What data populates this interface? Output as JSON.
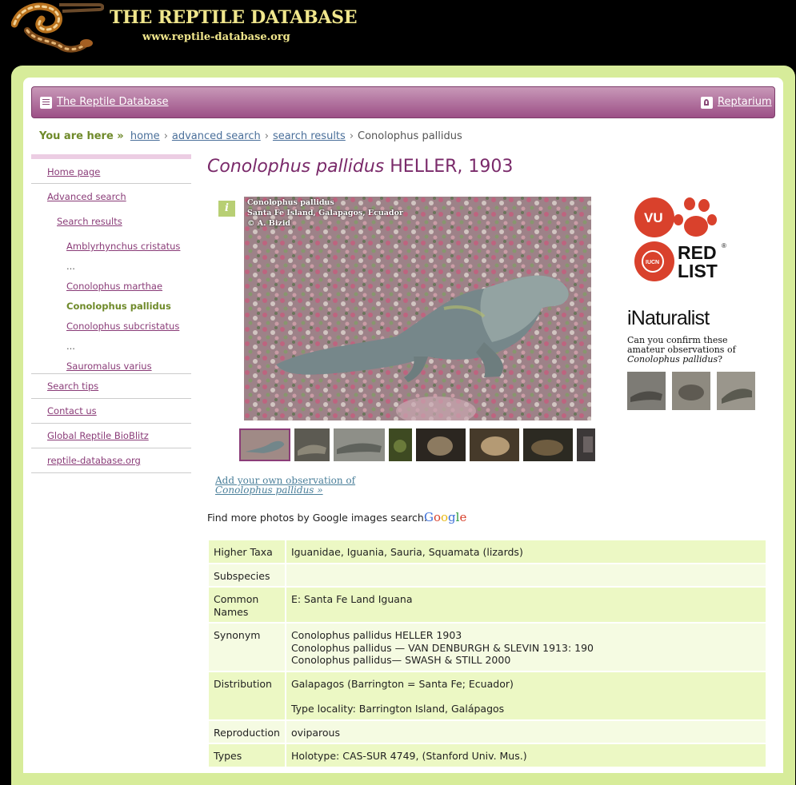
{
  "header": {
    "title": "THE REPTILE DATABASE",
    "url": "www.reptile-database.org"
  },
  "navbar": {
    "home_link": "The Reptile Database",
    "reptarium_link": "Reptarium"
  },
  "breadcrumb": {
    "here": "You are here »",
    "items": [
      "home",
      "advanced search",
      "search results"
    ],
    "current": "Conolophus pallidus",
    "separator": "›"
  },
  "sidebar": {
    "items": [
      {
        "label": "Home page"
      },
      {
        "label": "Advanced search"
      },
      {
        "label": "Search results"
      },
      {
        "label": "Amblyrhynchus cristatus"
      },
      {
        "label": "..."
      },
      {
        "label": "Conolophus marthae"
      },
      {
        "label": "Conolophus pallidus"
      },
      {
        "label": "Conolophus subcristatus"
      },
      {
        "label": "..."
      },
      {
        "label": "Sauromalus varius"
      },
      {
        "label": "Search tips"
      },
      {
        "label": "Contact us"
      },
      {
        "label": "Global Reptile BioBlitz"
      },
      {
        "label": "reptile-database.org"
      }
    ]
  },
  "species": {
    "genus_species": "Conolophus pallidus",
    "author": "HELLER, 1903"
  },
  "photo": {
    "info_icon": "i",
    "caption_lines": [
      "Conolophus pallidus",
      "Santa Fe Island, Galapagos, Ecuador",
      "© A. Bizid"
    ]
  },
  "add_observation": {
    "line1": "Add your own observation of",
    "species": "Conolophus pallidus",
    "suffix": " »"
  },
  "google": {
    "text": "Find more photos by Google images search:",
    "logo": "Google"
  },
  "redlist": {
    "status": "VU",
    "iucn": "IUCN",
    "label_line1": "RED",
    "label_line2": "LIST",
    "registered": "®"
  },
  "inaturalist": {
    "logo": "iNaturalist",
    "text": "Can you confirm these amateur observations of",
    "species": "Conolophus pallidus",
    "question": "?"
  },
  "table": {
    "higher_taxa_label": "Higher Taxa",
    "higher_taxa": "Iguanidae, Iguania, Sauria, Squamata (lizards)",
    "subspecies_label": "Subspecies",
    "common_names_label_1": "Common",
    "common_names_label_2": "Names",
    "common_names": "E: Santa Fe Land Iguana",
    "synonym_label": "Synonym",
    "synonym_1": "Conolophus pallidus HELLER 1903",
    "synonym_2": "Conolophus pallidus — VAN DENBURGH & SLEVIN 1913: 190",
    "synonym_3": "Conolophus pallidus— SWASH & STILL 2000",
    "distribution_label": "Distribution",
    "distribution_1": "Galapagos (Barrington = Santa Fe; Ecuador)",
    "distribution_2": "Type locality: Barrington Island, Galápagos",
    "reproduction_label": "Reproduction",
    "reproduction": "oviparous",
    "types_label": "Types",
    "types": "Holotype: CAS-SUR 4749, (Stanford Univ. Mus.)"
  },
  "colors": {
    "frame": "#d7ec9a",
    "nav_purple": "#9c4f86",
    "link_purple": "#8a3c78",
    "current_green": "#6f8a2a",
    "row_green": "#ecf8c4",
    "row_light": "#f5fbe2",
    "iucn_red": "#d9412c"
  }
}
